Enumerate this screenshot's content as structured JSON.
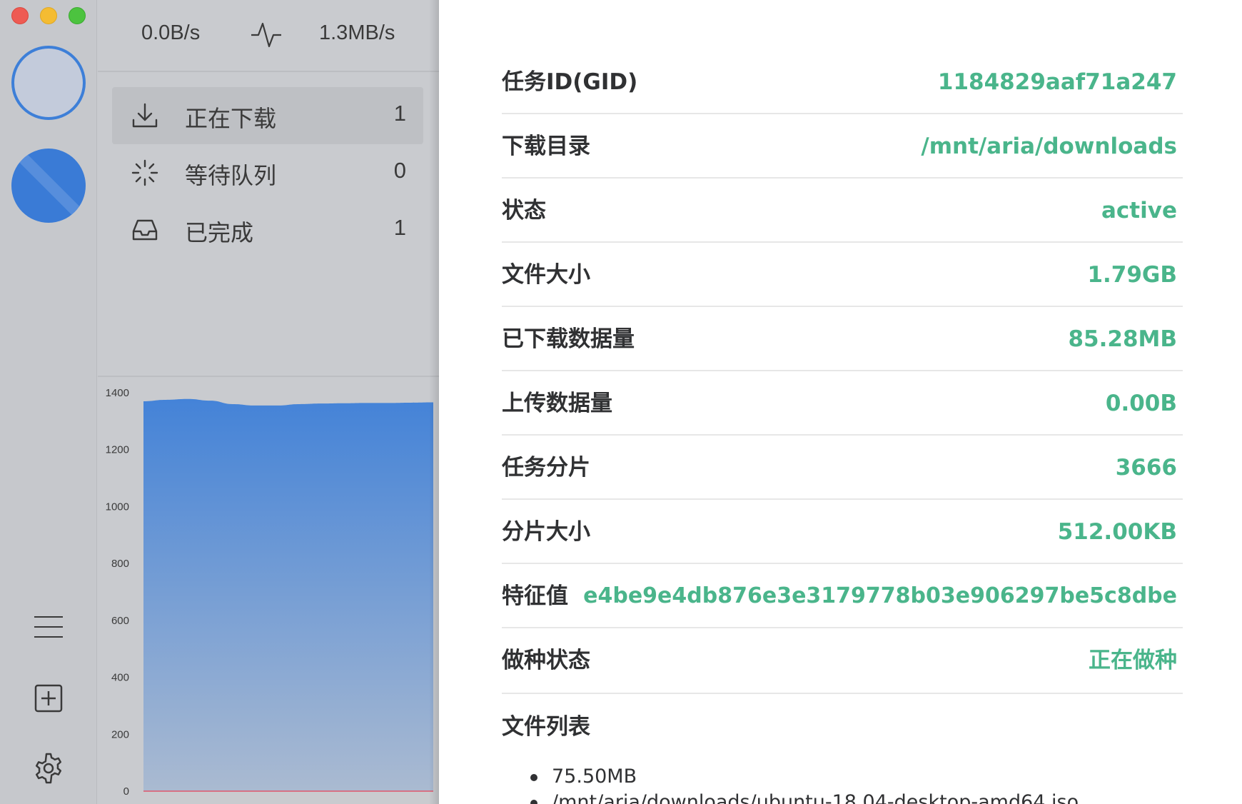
{
  "toolbar": {
    "download_speed": "0.0B/s",
    "upload_speed": "1.3MB/s"
  },
  "nav": [
    {
      "label": "正在下载",
      "count": "1",
      "icon": "download-icon",
      "active": true
    },
    {
      "label": "等待队列",
      "count": "0",
      "icon": "spinner-icon",
      "active": false
    },
    {
      "label": "已完成",
      "count": "1",
      "icon": "inbox-icon",
      "active": false
    }
  ],
  "chart_data": {
    "type": "area",
    "y_ticks": [
      "1400",
      "1200",
      "1000",
      "800",
      "600",
      "400",
      "200",
      "0"
    ],
    "ylim": [
      0,
      1400
    ],
    "series": [
      {
        "values": [
          1370,
          1375,
          1378,
          1372,
          1360,
          1355,
          1355,
          1360,
          1362,
          1363,
          1364,
          1364,
          1365,
          1366
        ],
        "color": "#3d7fd8"
      },
      {
        "values": [
          0,
          0,
          0,
          0,
          0,
          0,
          0,
          0,
          0,
          0,
          0,
          0,
          0,
          0
        ],
        "color": "#e0566b"
      }
    ],
    "grid": false
  },
  "details": {
    "rows": [
      {
        "label": "任务ID(GID)",
        "value": "1184829aaf71a247"
      },
      {
        "label": "下载目录",
        "value": "/mnt/aria/downloads"
      },
      {
        "label": "状态",
        "value": "active"
      },
      {
        "label": "文件大小",
        "value": "1.79GB"
      },
      {
        "label": "已下载数据量",
        "value": "85.28MB"
      },
      {
        "label": "上传数据量",
        "value": "0.00B"
      },
      {
        "label": "任务分片",
        "value": "3666"
      },
      {
        "label": "分片大小",
        "value": "512.00KB"
      },
      {
        "label": "特征值",
        "value": "e4be9e4db876e3e3179778b03e906297be5c8dbe"
      },
      {
        "label": "做种状态",
        "value": "正在做种"
      }
    ],
    "files_label": "文件列表",
    "files": [
      "75.50MB",
      "/mnt/aria/downloads/ubuntu-18.04-desktop-amd64.iso"
    ]
  },
  "colors": {
    "accent_blue": "#3d7fd8",
    "value_green": "#4ab58b"
  }
}
